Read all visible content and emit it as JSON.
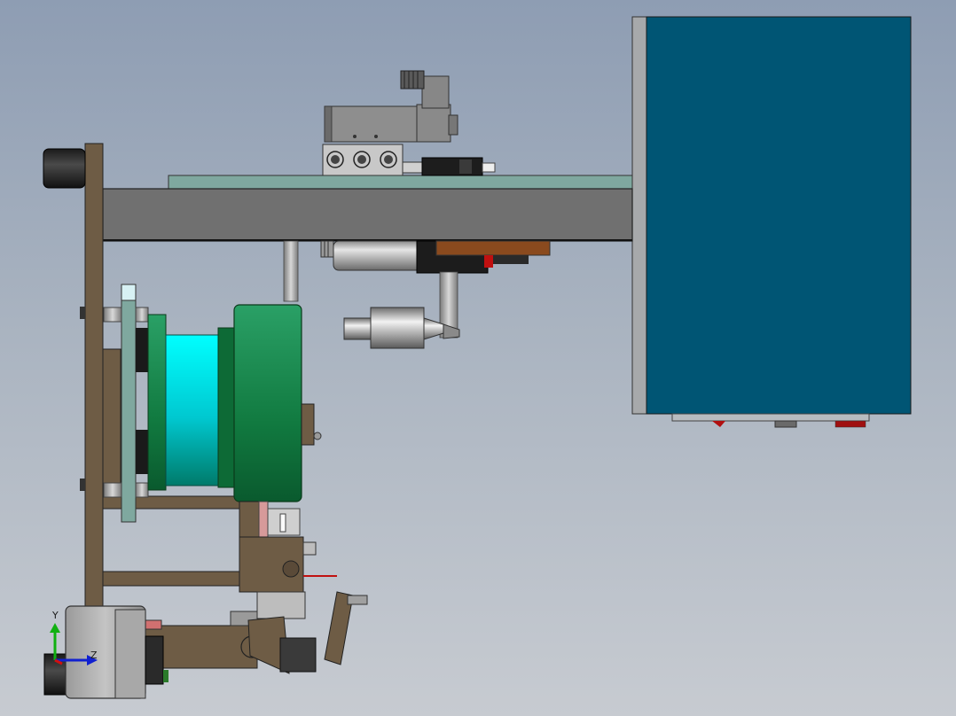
{
  "viewport": {
    "background_top": "#8e9db3",
    "background_bottom": "#c7cbd1"
  },
  "colors": {
    "cabinet_face": "#005574",
    "frame_bronze": "#6e5c45",
    "beam_gray": "#707070",
    "plate_teal": "#7fa89f",
    "drum_green": "#1a7f45",
    "hub_cyan": "#00d8e4",
    "valve_gray": "#8a8a8a",
    "axis_x": "#d01010",
    "axis_y": "#10b010",
    "axis_z": "#1020d0"
  },
  "triad": {
    "y_label": "Y",
    "z_label": "Z"
  }
}
